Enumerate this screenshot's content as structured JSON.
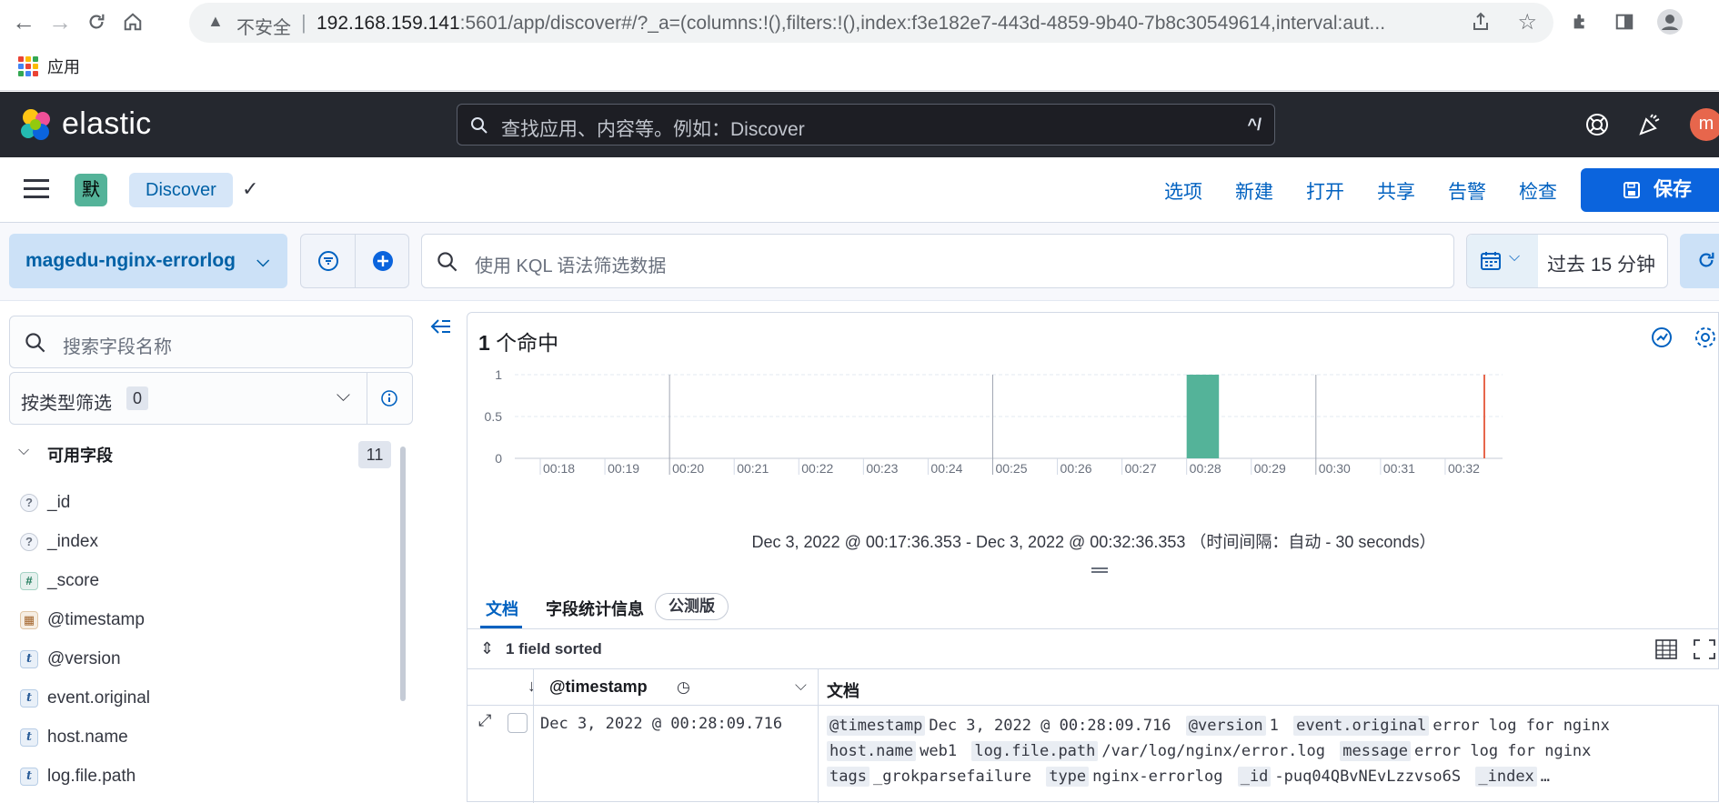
{
  "browser": {
    "insecure_label": "不安全",
    "url_host": "192.168.159.141",
    "url_rest": ":5601/app/discover#/?_a=(columns:!(),filters:!(),index:f3e182e7-443d-4859-9b40-7b8c30549614,interval:aut...",
    "bookmark_apps": "应用"
  },
  "header": {
    "brand": "elastic",
    "search_placeholder": "查找应用、内容等。例如：Discover",
    "search_shortcut": "^/",
    "avatar_letter": "m"
  },
  "appbar": {
    "space_letter": "默",
    "breadcrumb": "Discover",
    "menu": [
      "选项",
      "新建",
      "打开",
      "共享",
      "告警",
      "检查"
    ],
    "save_label": "保存"
  },
  "query": {
    "data_view": "magedu-nginx-errorlog",
    "kql_placeholder": "使用 KQL 语法筛选数据",
    "time_range": "过去 15 分钟"
  },
  "sidebar": {
    "field_search_placeholder": "搜索字段名称",
    "type_filter_label": "按类型筛选",
    "type_filter_count": "0",
    "available_title": "可用字段",
    "available_count": "11",
    "fields": [
      {
        "name": "_id",
        "type": "unknown",
        "token": "?"
      },
      {
        "name": "_index",
        "type": "unknown",
        "token": "?"
      },
      {
        "name": "_score",
        "type": "number",
        "token": "#"
      },
      {
        "name": "@timestamp",
        "type": "date",
        "token": "▦"
      },
      {
        "name": "@version",
        "type": "string",
        "token": "t"
      },
      {
        "name": "event.original",
        "type": "string",
        "token": "t"
      },
      {
        "name": "host.name",
        "type": "string",
        "token": "t"
      },
      {
        "name": "log.file.path",
        "type": "string",
        "token": "t"
      }
    ]
  },
  "main": {
    "hit_count": "1",
    "hit_label": " 个命中",
    "interval_text": "Dec 3, 2022 @ 00:17:36.353 - Dec 3, 2022 @ 00:32:36.353 （时间间隔：自动 - 30 seconds）",
    "tabs": {
      "docs": "文档",
      "field_stats": "字段统计信息",
      "beta": "公测版"
    },
    "sorted_label": "1 field sorted",
    "col_timestamp": "@timestamp",
    "col_document": "文档",
    "row": {
      "timestamp": "Dec 3, 2022 @ 00:28:09.716",
      "doc_pairs": [
        {
          "k": "@timestamp",
          "v": "Dec 3, 2022 @ 00:28:09.716"
        },
        {
          "k": "@version",
          "v": "1"
        },
        {
          "k": "event.original",
          "v": "error log for nginx"
        },
        {
          "k": "host.name",
          "v": "web1"
        },
        {
          "k": "log.file.path",
          "v": "/var/log/nginx/error.log"
        },
        {
          "k": "message",
          "v": "error log for nginx"
        },
        {
          "k": "tags",
          "v": "_grokparsefailure"
        },
        {
          "k": "type",
          "v": "nginx-errorlog"
        },
        {
          "k": "_id",
          "v": "-puq04QBvNEvLzzvso6S"
        },
        {
          "k": "_index",
          "v": "…"
        }
      ]
    }
  },
  "chart_data": {
    "type": "bar",
    "x_ticks": [
      "00:18",
      "00:19",
      "00:20",
      "00:21",
      "00:22",
      "00:23",
      "00:24",
      "00:25",
      "00:26",
      "00:27",
      "00:28",
      "00:29",
      "00:30",
      "00:31",
      "00:32"
    ],
    "x_date_label": "December 3, 2022",
    "y_ticks": [
      "0",
      "0.5",
      "1"
    ],
    "ylim": [
      0,
      1
    ],
    "bars": [
      {
        "x": "00:28:00",
        "value": 1
      }
    ],
    "bar_color": "#54b399",
    "now_marker_color": "#e7664c"
  },
  "colors": {
    "accent": "#0b64dd",
    "header_bg": "#25282f",
    "bar": "#54b399"
  }
}
